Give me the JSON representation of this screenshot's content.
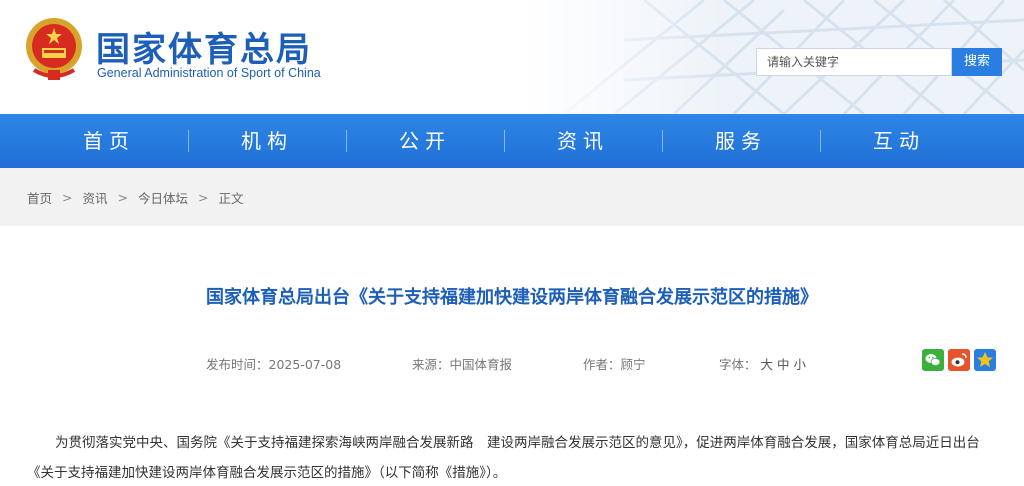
{
  "header": {
    "title": "国家体育总局",
    "subtitle": "General Administration of Sport of China",
    "search_placeholder": "请输入关键字",
    "search_button": "搜索"
  },
  "nav": {
    "items": [
      {
        "label": "首页"
      },
      {
        "label": "机构"
      },
      {
        "label": "公开"
      },
      {
        "label": "资讯"
      },
      {
        "label": "服务"
      },
      {
        "label": "互动"
      }
    ]
  },
  "breadcrumb": {
    "items": [
      "首页",
      "资讯",
      "今日体坛",
      "正文"
    ],
    "separator": ">"
  },
  "article": {
    "title": "国家体育总局出台《关于支持福建加快建设两岸体育融合发展示范区的措施》",
    "date_label": "发布时间：2025-07-08",
    "source_label": "来源：中国体育报",
    "author_label": "作者：顾宁",
    "font_label": "字体：",
    "font_sizes": [
      "大",
      "中",
      "小"
    ],
    "body": "为贯彻落实党中央、国务院《关于支持福建探索海峡两岸融合发展新路　建设两岸融合发展示范区的意见》，促进两岸体育融合发展，国家体育总局近日出台《关于支持福建加快建设两岸体育融合发展示范区的措施》（以下简称《措施》）。"
  },
  "share": {
    "icons": [
      "wechat-icon",
      "weibo-icon",
      "favorite-icon"
    ],
    "colors": {
      "wechat": "#3bb03b",
      "weibo": "#e6532d",
      "favorite": "#f2a51b"
    }
  },
  "colors": {
    "brand": "#1d5fb8",
    "nav": "#1f6fd6",
    "search_button": "#2a7de1"
  }
}
